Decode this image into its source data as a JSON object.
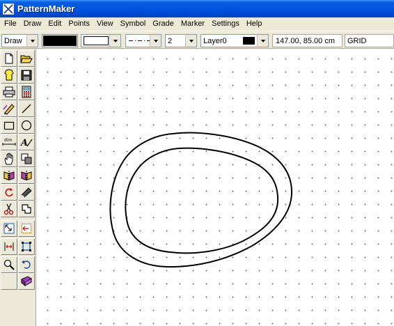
{
  "window": {
    "title": "PatternMaker"
  },
  "menu": [
    "File",
    "Draw",
    "Edit",
    "Points",
    "View",
    "Symbol",
    "Grade",
    "Marker",
    "Settings",
    "Help"
  ],
  "toolbar": {
    "mode": "Draw",
    "line_width": "2",
    "layer": "Layer0",
    "coordinates": "147.00, 85.00 cm",
    "grid_label": "GRID",
    "colors": {
      "fill": "#000000",
      "outline": "#ffffff",
      "layer_color": "#000000"
    }
  },
  "tools": [
    "new-document-icon",
    "open-folder-icon",
    "new-pattern-icon",
    "save-icon",
    "print-icon",
    "calculator-icon",
    "pencil-icon",
    "line-icon",
    "rectangle-icon",
    "circle-icon",
    "dimension-icon",
    "text-icon",
    "hand-icon",
    "copy-layers-icon",
    "mirror-icon",
    "mirror-alt-icon",
    "rotate-icon",
    "curve-tool-icon",
    "scissors-icon",
    "trace-icon",
    "zoom-fit-icon",
    "move-icon",
    "dimension-arrows-icon",
    "transform-icon",
    "zoom-icon",
    "undo-icon",
    "library-icon"
  ]
}
